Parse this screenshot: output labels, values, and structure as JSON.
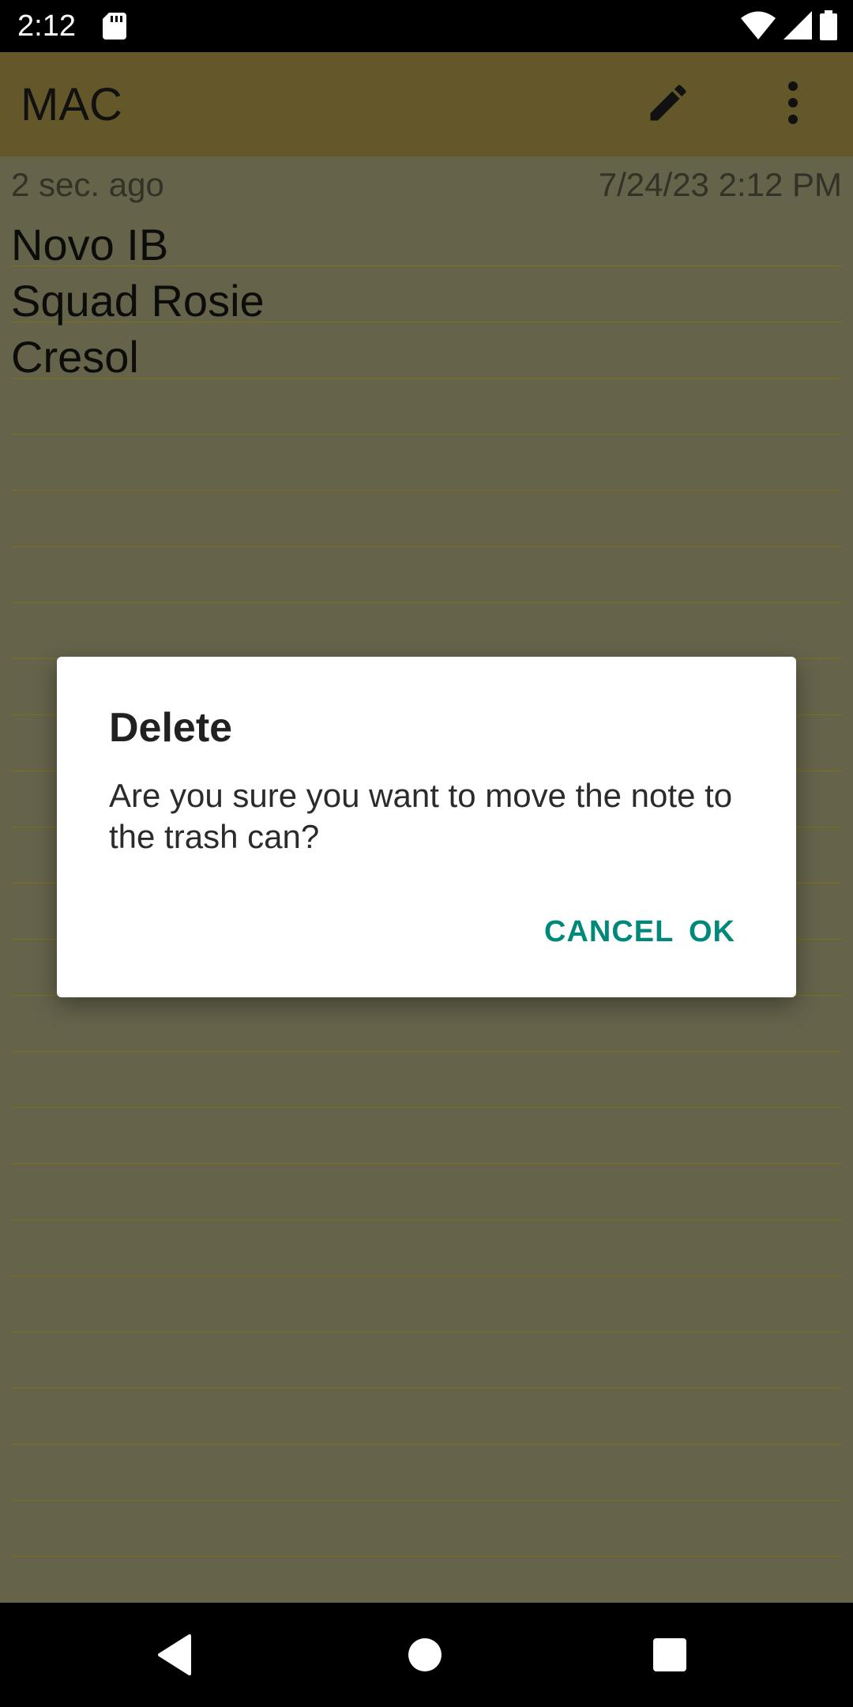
{
  "status_bar": {
    "time": "2:12",
    "icons": [
      "sd-card-icon",
      "wifi-icon",
      "signal-icon",
      "battery-icon"
    ]
  },
  "app_bar": {
    "title": "MAC",
    "actions": [
      "edit-icon",
      "more-vert-icon"
    ]
  },
  "note": {
    "relative_time": "2 sec. ago",
    "date": "7/24/23 2:12 PM",
    "lines": [
      "Novo IB",
      "Squad Rosie",
      "Cresol"
    ]
  },
  "dialog": {
    "title": "Delete",
    "message": "Are you sure you want to move the note to the trash can?",
    "cancel_label": "CANCEL",
    "ok_label": "OK"
  },
  "nav_bar": {
    "icons": [
      "back-icon",
      "home-icon",
      "recents-icon"
    ]
  },
  "colors": {
    "app_bar": "#64582a",
    "note_background": "#65634a",
    "accent": "#00897b"
  }
}
